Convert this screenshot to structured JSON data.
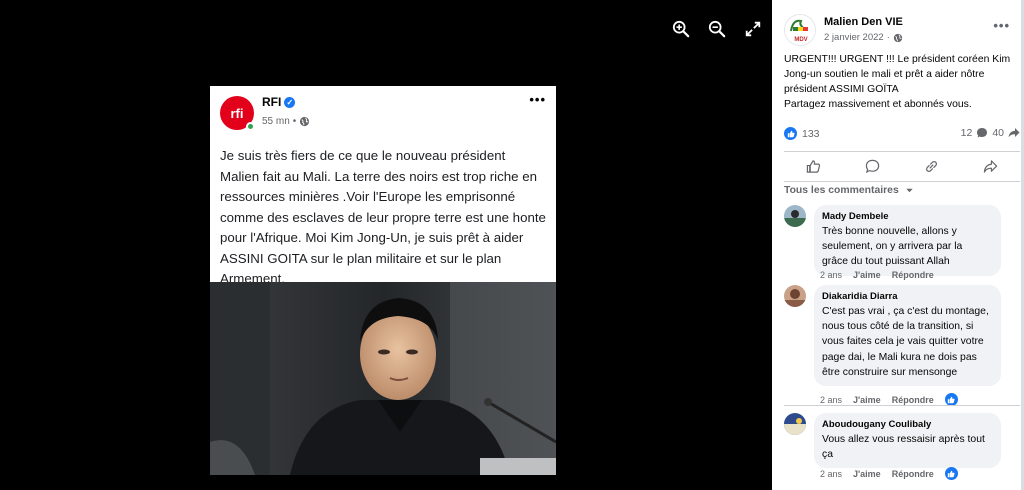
{
  "viewer": {
    "tools": [
      {
        "icon": "zoom-in-icon"
      },
      {
        "icon": "zoom-out-icon"
      },
      {
        "icon": "fullscreen-icon"
      }
    ],
    "embedded_post": {
      "source_name": "RFI",
      "logo_text": "rfi",
      "time": "55 mn",
      "text": "Je suis très fiers de ce que le nouveau président Malien fait au Mali. La terre des noirs est trop riche en ressources minières .Voir l'Europe les emprisonné comme des esclaves de leur propre terre est une honte pour l'Afrique. Moi Kim Jong-Un, je suis prêt à aider ASSINI GOITA sur le plan militaire et sur le plan Armement."
    }
  },
  "post": {
    "page_name": "Malien Den VIE",
    "avatar_text": "MDV",
    "date": "2 janvier 2022",
    "body_lines": [
      "URGENT!!! URGENT !!! Le président coréen Kim Jong-un soutien le mali et prêt a aider nôtre président ASSIMI GOÏTA",
      "Partagez massivement et abonnés vous."
    ],
    "reactions_count": "133",
    "comments_count": "12",
    "shares_count": "40"
  },
  "comments_filter": "Tous les commentaires",
  "comments": [
    {
      "author": "Mady Dembele",
      "text": "Très bonne nouvelle, allons y seulement, on y arrivera par la grâce du tout puissant Allah",
      "age": "2 ans",
      "like_label": "J'aime",
      "reply_label": "Répondre"
    },
    {
      "author": "Diakaridia Diarra",
      "text": "C'est pas vrai , ça c'est du montage, nous tous côté de la transition, si vous faites cela je vais quitter votre page dai, le Mali kura ne dois pas être construire sur mensonge",
      "age": "2 ans",
      "like_label": "J'aime",
      "reply_label": "Répondre"
    },
    {
      "author": "Aboudougany Coulibaly",
      "text": "Vous allez vous ressaisir après tout ça",
      "age": "2 ans",
      "like_label": "J'aime",
      "reply_label": "Répondre"
    }
  ],
  "colors": {
    "facebook_blue": "#1877f2",
    "rfi_red": "#e2001a",
    "bubble_bg": "#f0f2f5"
  }
}
